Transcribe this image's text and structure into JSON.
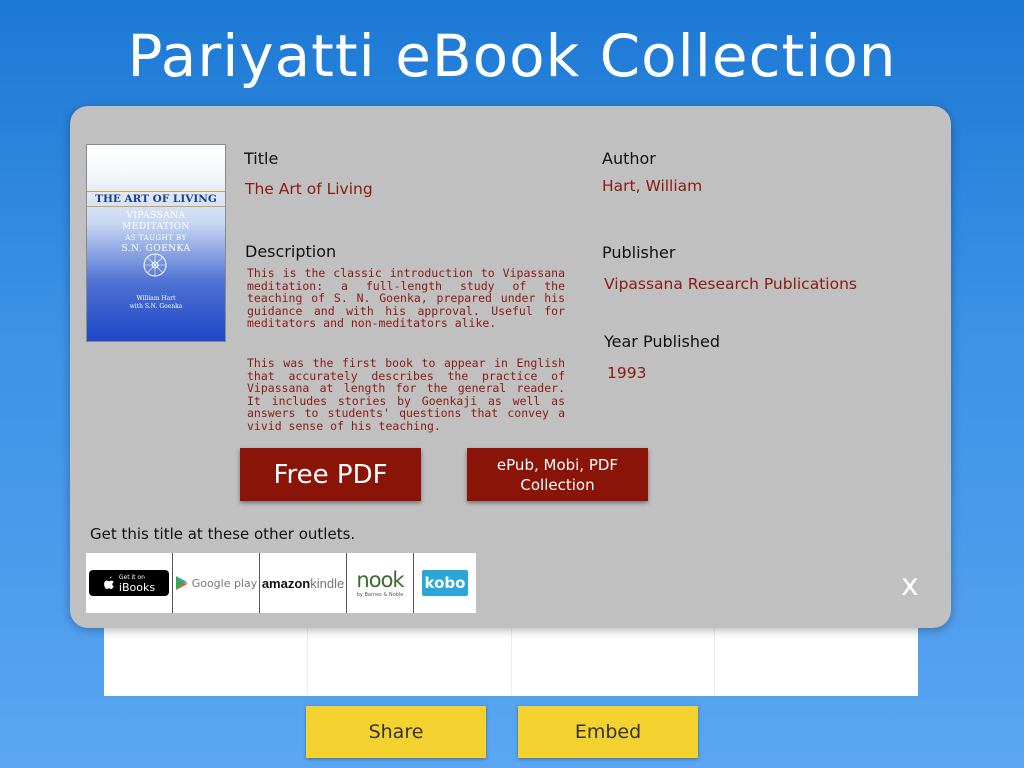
{
  "page": {
    "title": "Pariyatti eBook Collection"
  },
  "book": {
    "cover": {
      "title": "THE ART OF LIVING",
      "subtitle_line1": "VIPASSANA",
      "subtitle_line2": "MEDITATION",
      "subtitle_line3": "AS TAUGHT BY",
      "subtitle_line4": "S.N. GOENKA",
      "author_line1": "William Hart",
      "author_line2": "with S.N. Goenka"
    },
    "title_label": "Title",
    "title": "The Art of Living",
    "author_label": "Author",
    "author": "Hart, William",
    "description_label": "Description",
    "description_p1": "This is the classic introduction to Vipassana meditation: a full-length study of the teaching of S. N. Goenka, prepared under his guidance and with his approval. Useful for meditators and non-meditators alike.",
    "description_p2": "This was the first book to appear in English that accurately describes the practice of Vipassana at length for the general reader. It includes stories by Goenkaji as well as answers to students' questions that convey a vivid sense of his teaching.",
    "publisher_label": "Publisher",
    "publisher": "Vipassana Research Publications",
    "year_label": "Year Published",
    "year": "1993"
  },
  "actions": {
    "free_pdf": "Free PDF",
    "collection_line1": "ePub, Mobi, PDF",
    "collection_line2": "Collection"
  },
  "outlets": {
    "label": "Get this title at these other outlets.",
    "ibooks_small": "Get it on",
    "ibooks_big": "iBooks",
    "google": "Google play",
    "amazon": "amazon",
    "kindle": "kindle",
    "nook": "nook",
    "nook_small": "by Barnes & Noble",
    "kobo": "kobo"
  },
  "modal": {
    "close": "X"
  },
  "footer": {
    "share": "Share",
    "embed": "Embed"
  },
  "colors": {
    "accent_red": "#8b1408",
    "value_text": "#8b1a10",
    "footer_button": "#f3d22f",
    "modal_bg": "#c0c0c0"
  },
  "icons": {
    "ibooks": "apple-icon",
    "google": "google-play-icon",
    "cover": "dharma-wheel-icon"
  }
}
